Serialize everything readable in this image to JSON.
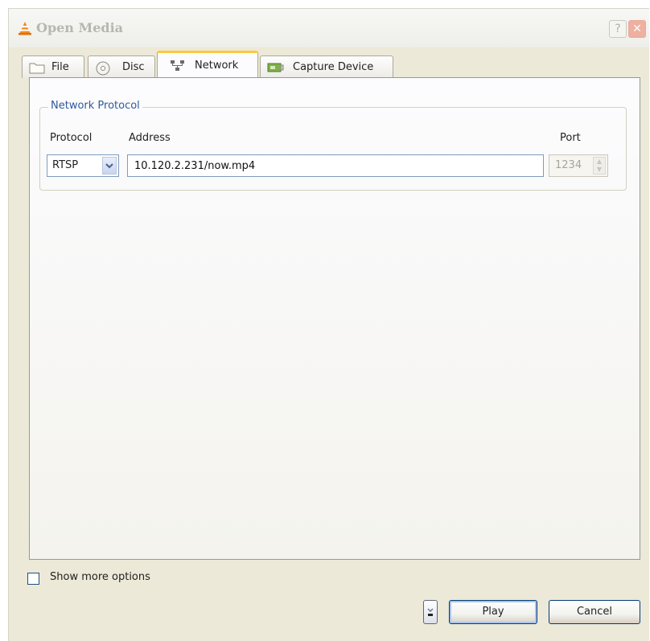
{
  "window": {
    "title": "Open Media",
    "help_label": "?",
    "close_label": "✕"
  },
  "tabs": [
    {
      "label": "File",
      "icon": "folder-icon",
      "active": false
    },
    {
      "label": "Disc",
      "icon": "disc-icon",
      "active": false
    },
    {
      "label": "Network",
      "icon": "network-icon",
      "active": true
    },
    {
      "label": "Capture Device",
      "icon": "capture-card-icon",
      "active": false
    }
  ],
  "network": {
    "group_title": "Network Protocol",
    "protocol_label": "Protocol",
    "address_label": "Address",
    "port_label": "Port",
    "protocol_value": "RTSP",
    "address_value": "10.120.2.231/now.mp4",
    "port_value": "1234"
  },
  "options": {
    "show_more_label": "Show more options",
    "show_more_checked": false
  },
  "buttons": {
    "play_label": "Play",
    "cancel_label": "Cancel"
  },
  "colors": {
    "accent_tab": "#ffc83c",
    "group_title": "#2f5aa0",
    "window_bg": "#ece9d8"
  }
}
